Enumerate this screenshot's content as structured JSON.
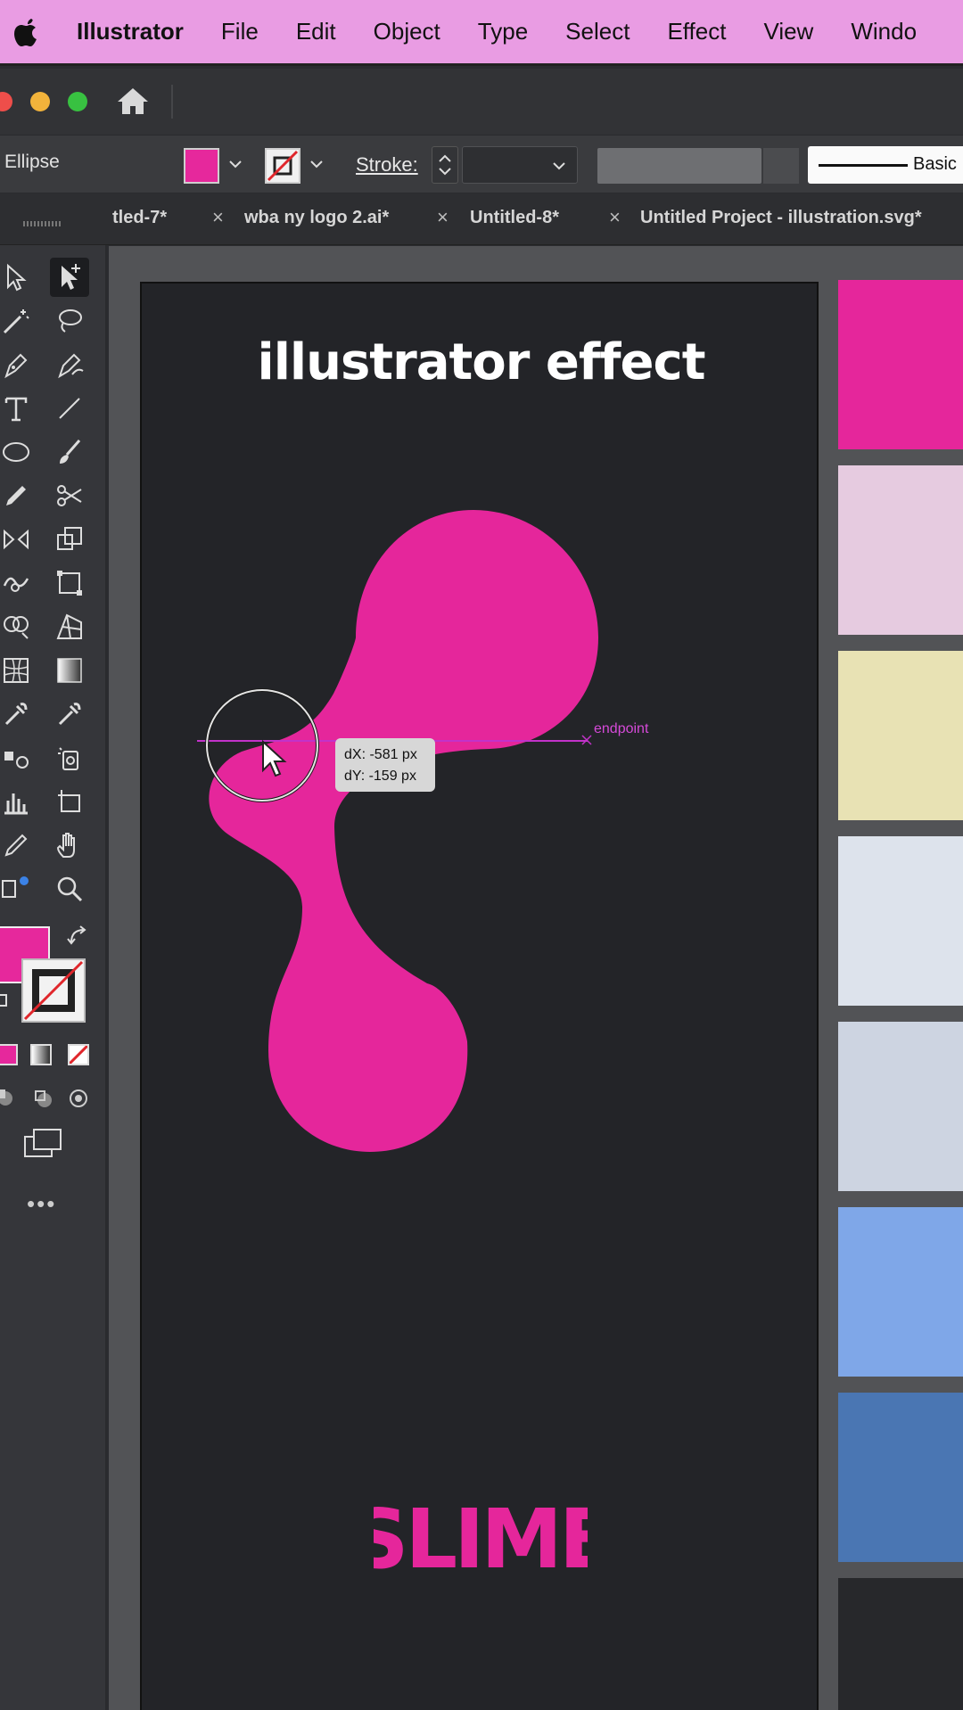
{
  "menubar": {
    "app": "Illustrator",
    "items": [
      "File",
      "Edit",
      "Object",
      "Type",
      "Select",
      "Effect",
      "View",
      "Windo"
    ]
  },
  "controlbar": {
    "tool_label": "Ellipse",
    "stroke_label": "Stroke:",
    "brush_label": "Basic"
  },
  "tabs": [
    {
      "label": "tled-7*"
    },
    {
      "label": "wba ny logo 2.ai*"
    },
    {
      "label": "Untitled-8*"
    },
    {
      "label": "Untitled Project - illustration.svg*"
    }
  ],
  "artboard": {
    "title": "illustrator effect",
    "logo_text": "SLIME"
  },
  "smart_guide": {
    "dx": "dX: -581 px",
    "dy": "dY: -159 px",
    "endpoint": "endpoint"
  },
  "colors": {
    "accent_pink": "#e6289c",
    "menubar": "#e99ce3",
    "swatches": [
      "#e5269b",
      "#e6cbe0",
      "#e8e2b4",
      "#dde3ec",
      "#cdd4e1",
      "#7fa7e8",
      "#4a76b3",
      "#27282b"
    ]
  },
  "icons": {
    "tools": [
      "selection-icon",
      "direct-selection-icon",
      "magic-wand-icon",
      "lasso-icon",
      "pen-icon",
      "curvature-icon",
      "type-icon",
      "line-icon",
      "ellipse-icon",
      "paintbrush-icon",
      "pencil-icon",
      "scissors-icon",
      "rotate-icon",
      "scale-icon",
      "warp-icon",
      "free-transform-icon",
      "shape-builder-icon",
      "perspective-grid-icon",
      "mesh-icon",
      "gradient-icon",
      "eyedropper-icon",
      "blend-icon",
      "symbol-sprayer-icon",
      "graph-icon",
      "column-graph-icon",
      "artboard-icon",
      "slice-icon",
      "hand-icon",
      "zoom-icon"
    ]
  }
}
